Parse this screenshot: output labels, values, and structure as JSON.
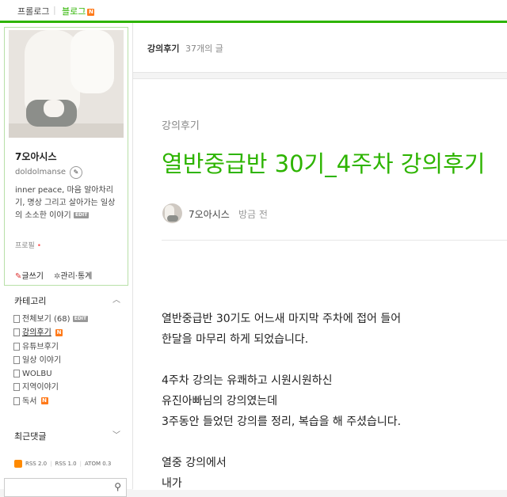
{
  "topnav": {
    "prolog": "프롤로그",
    "blog": "블로그",
    "blog_badge": "N"
  },
  "sidebar": {
    "blog_name": "7오아시스",
    "blog_id": "doldolmanse",
    "bio": "inner peace, 마음 알아차리기, 명상 그리고 살아가는 일상의 소소한 이야기",
    "bio_badge": "EDIT",
    "profile_link": "프로필",
    "profile_dot": "•",
    "write": "글쓰기",
    "manage": "관리·통계",
    "categories_header": "카테고리",
    "categories": {
      "all": {
        "label": "전체보기",
        "count": "(68)",
        "badge": "EDIT"
      },
      "items": [
        {
          "label": "강의후기",
          "badge": "N",
          "active": true
        },
        {
          "label": "유튜브후기",
          "badge": "",
          "active": false
        },
        {
          "label": "일상 이야기",
          "badge": "",
          "active": false
        },
        {
          "label": "WOLBU",
          "badge": "",
          "active": false
        },
        {
          "label": "지역이야기",
          "badge": "",
          "active": false
        },
        {
          "label": "독서",
          "badge": "N",
          "active": false
        }
      ]
    },
    "recent_header": "최근댓글",
    "rss": [
      "RSS 2.0",
      "RSS 1.0",
      "ATOM 0.3"
    ]
  },
  "main": {
    "category": "강의후기",
    "post_count": "37개의 글"
  },
  "post": {
    "category": "강의후기",
    "title": "열반중급반 30기_4주차 강의후기",
    "author": "7오아시스",
    "time": "방금 전",
    "body": [
      "열반중급반 30기도 어느새 마지막 주차에 접어 들어",
      "한달을 마무리 하게 되었습니다.",
      "",
      "4주차 강의는 유쾌하고 시원시원하신",
      "유진아빠님의 강의였는데",
      "3주동안 들었던 강의를 정리, 복습을 해 주셨습니다.",
      "",
      "열중 강의에서",
      "내가"
    ]
  },
  "colors": {
    "brand_green": "#2db400",
    "new_badge": "#ff7a1a"
  }
}
